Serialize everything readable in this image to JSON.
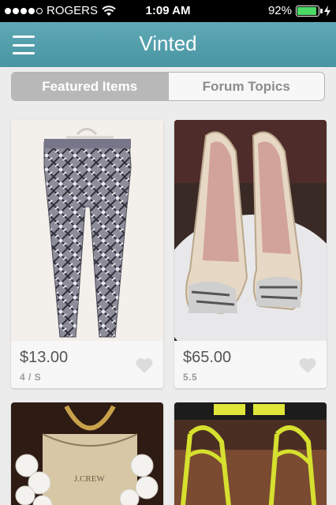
{
  "status_bar": {
    "carrier": "ROGERS",
    "time": "1:09 AM",
    "battery": "92%",
    "battery_level": 0.92,
    "signal_bars": 4,
    "signal_total": 5
  },
  "header": {
    "title": "Vinted",
    "menu_icon": "hamburger-menu-icon",
    "color": "#55a0ad"
  },
  "tabs": [
    {
      "label": "Featured Items",
      "active": true
    },
    {
      "label": "Forum Topics",
      "active": false
    }
  ],
  "items": [
    {
      "price": "$13.00",
      "size": "4 / S",
      "image": "patterned leggings"
    },
    {
      "price": "$65.00",
      "size": "5.5",
      "image": "beige peep-toe heels"
    },
    {
      "price": "",
      "size": "",
      "image": "white flower statement necklace"
    },
    {
      "price": "",
      "size": "",
      "image": "yellow strappy heels"
    }
  ]
}
